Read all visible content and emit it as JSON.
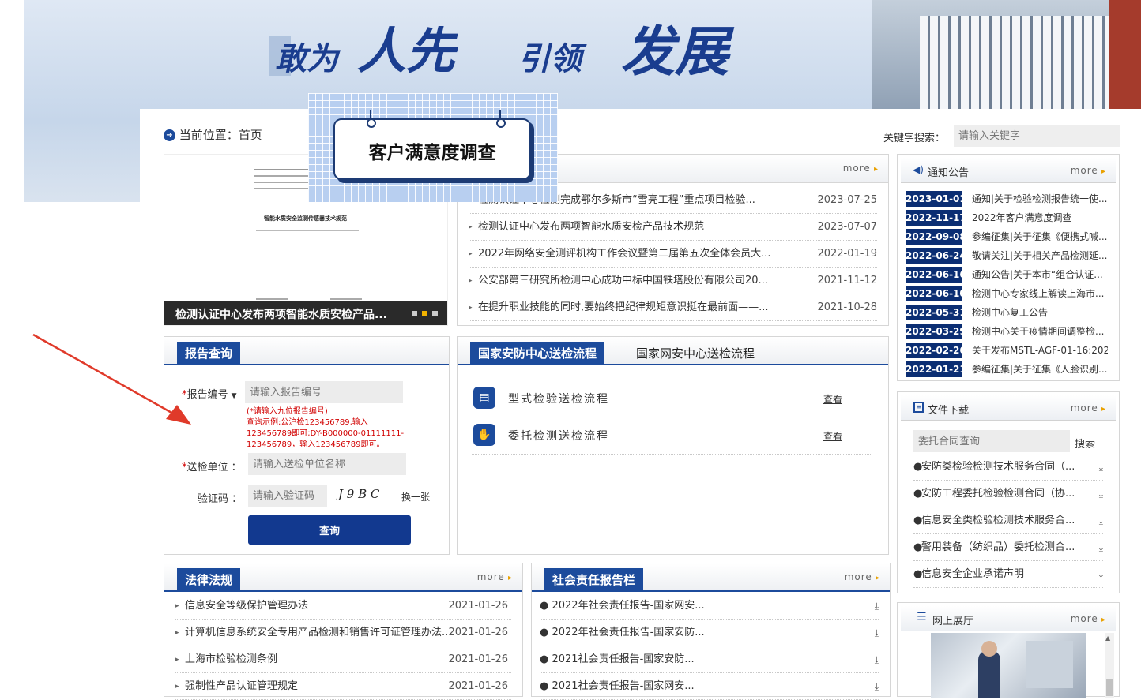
{
  "banner": {
    "slogan_words": [
      "敢为",
      "人先",
      "引领",
      "发展"
    ]
  },
  "breadcrumb": {
    "label": "当前位置：首页"
  },
  "search": {
    "label": "关键字搜索：",
    "placeholder": "请输入关键字"
  },
  "popup": {
    "title": "客户满意度调查"
  },
  "slideshow": {
    "caption": "检测认证中心发布两项智能水质安检产品...",
    "doc_title": "智能水质安全监测传感器技术规范"
  },
  "news": {
    "more": "more",
    "items": [
      {
        "title": "检测认证中心检测完成鄂尔多斯市“雪亮工程”重点项目检验...",
        "date": "2023-07-25"
      },
      {
        "title": "检测认证中心发布两项智能水质安检产品技术规范",
        "date": "2023-07-07"
      },
      {
        "title": "2022年网络安全测评机构工作会议暨第二届第五次全体会员大...",
        "date": "2022-01-19"
      },
      {
        "title": "公安部第三研究所检测中心成功中标中国铁塔股份有限公司20...",
        "date": "2021-11-12"
      },
      {
        "title": "在提升职业技能的同时,要始终把纪律规矩意识挺在最前面——...",
        "date": "2021-10-28"
      }
    ]
  },
  "notices": {
    "title": "通知公告",
    "more": "more",
    "items": [
      {
        "date": "2023-01-01",
        "title": "通知|关于检验检测报告统一使..."
      },
      {
        "date": "2022-11-17",
        "title": "2022年客户满意度调查"
      },
      {
        "date": "2022-09-08",
        "title": "参编征集|关于征集《便携式喊..."
      },
      {
        "date": "2022-06-24",
        "title": "敬请关注|关于相关产品检测延..."
      },
      {
        "date": "2022-06-16",
        "title": "通知公告|关于本市“组合认证..."
      },
      {
        "date": "2022-06-10",
        "title": "检测中心专家线上解读上海市..."
      },
      {
        "date": "2022-05-31",
        "title": "检测中心复工公告"
      },
      {
        "date": "2022-03-29",
        "title": "检测中心关于疫情期间调整检..."
      },
      {
        "date": "2022-02-26",
        "title": "关于发布MSTL-AGF-01-16:202..."
      },
      {
        "date": "2022-01-21",
        "title": "参编征集|关于征集《人脸识别..."
      }
    ]
  },
  "report": {
    "title": "报告查询",
    "number_label": "报告编号",
    "number_placeholder": "请输入报告编号",
    "hint_line1": "(*请输入九位报告编号)",
    "hint_line2": "查询示例:公沪检123456789,输入",
    "hint_line3": "123456789即可;DY-B000000-01111111-",
    "hint_line4": "123456789，输入123456789即可。",
    "unit_label": "送检单位 ：",
    "unit_placeholder": "请输入送检单位名称",
    "captcha_label": "验证码 ：",
    "captcha_placeholder": "请输入验证码",
    "captcha_text": "J 9 B C",
    "refresh": "换一张",
    "submit": "查询"
  },
  "flows": {
    "tab1": "国家安防中心送检流程",
    "tab2": "国家网安中心送检流程",
    "items": [
      {
        "title": "型式检验送检流程",
        "view": "查看"
      },
      {
        "title": "委托检测送检流程",
        "view": "查看"
      }
    ]
  },
  "downloads": {
    "title": "文件下载",
    "more": "more",
    "search_placeholder": "委托合同查询",
    "search_button": "搜索",
    "items": [
      "安防类检验检测技术服务合同（...",
      "安防工程委托检验检测合同（协...",
      "信息安全类检验检测技术服务合...",
      "警用装备（纺织品）委托检测合...",
      "信息安全企业承诺声明"
    ]
  },
  "laws": {
    "title": "法律法规",
    "more": "more",
    "items": [
      {
        "title": "信息安全等级保护管理办法",
        "date": "2021-01-26"
      },
      {
        "title": "计算机信息系统安全专用产品检测和销售许可证管理办法...",
        "date": "2021-01-26"
      },
      {
        "title": "上海市检验检测条例",
        "date": "2021-01-26"
      },
      {
        "title": "强制性产品认证管理规定",
        "date": "2021-01-26"
      }
    ]
  },
  "social": {
    "title": "社会责任报告栏",
    "more": "more",
    "items": [
      "2022年社会责任报告-国家网安...",
      "2022年社会责任报告-国家安防...",
      "2021社会责任报告-国家安防...",
      "2021社会责任报告-国家网安..."
    ]
  },
  "exhibition": {
    "title": "网上展厅",
    "more": "more"
  }
}
